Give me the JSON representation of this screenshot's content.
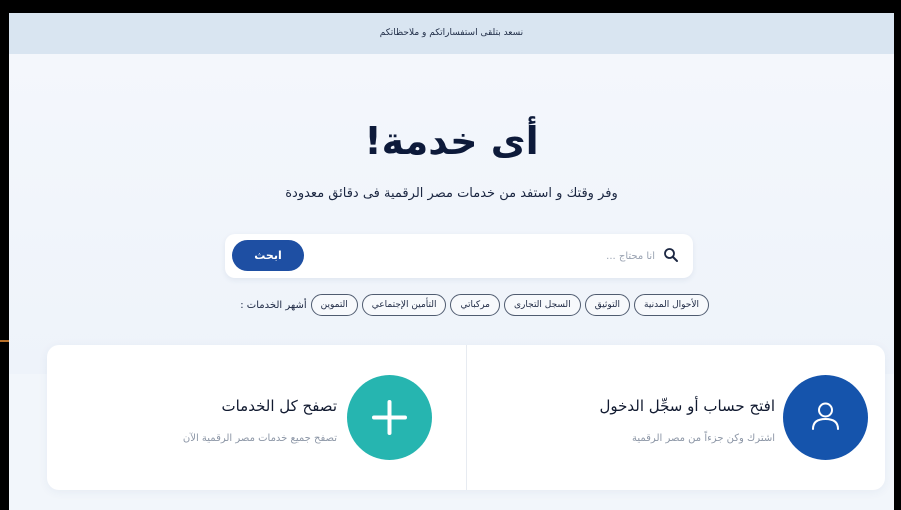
{
  "topbar": {
    "text": "نسعد بتلقى استفساراتكم و ملاحظاتكم"
  },
  "hero": {
    "title": "أى خدمة!",
    "subtitle": "وفر وقتك و استفد من خدمات مصر الرقمية فى دقائق معدودة"
  },
  "search": {
    "placeholder": "أنا محتاج ...",
    "button_label": "ابحث"
  },
  "popular": {
    "label": "أشهر الخدمات :",
    "chips": [
      "التموين",
      "التأمين الإجتماعي",
      "مركباتي",
      "السجل التجارى",
      "التوثيق",
      "الأحوال المدنية"
    ]
  },
  "cards": {
    "account": {
      "title": "افتح حساب أو سجِّل الدخول",
      "subtitle": "اشترك وكن جزءاً من مصر الرقمية"
    },
    "browse": {
      "title": "تصفح كل الخدمات",
      "subtitle": "تصفح جميع خدمات مصر الرقمية الآن"
    }
  },
  "colors": {
    "primary_button": "#1e4fa3",
    "plus_circle": "#26b5b0",
    "user_circle": "#1554ac",
    "topbar_bg": "#d9e5f1"
  },
  "icons": {
    "search": "search-icon",
    "plus": "plus-icon",
    "user": "user-icon"
  }
}
